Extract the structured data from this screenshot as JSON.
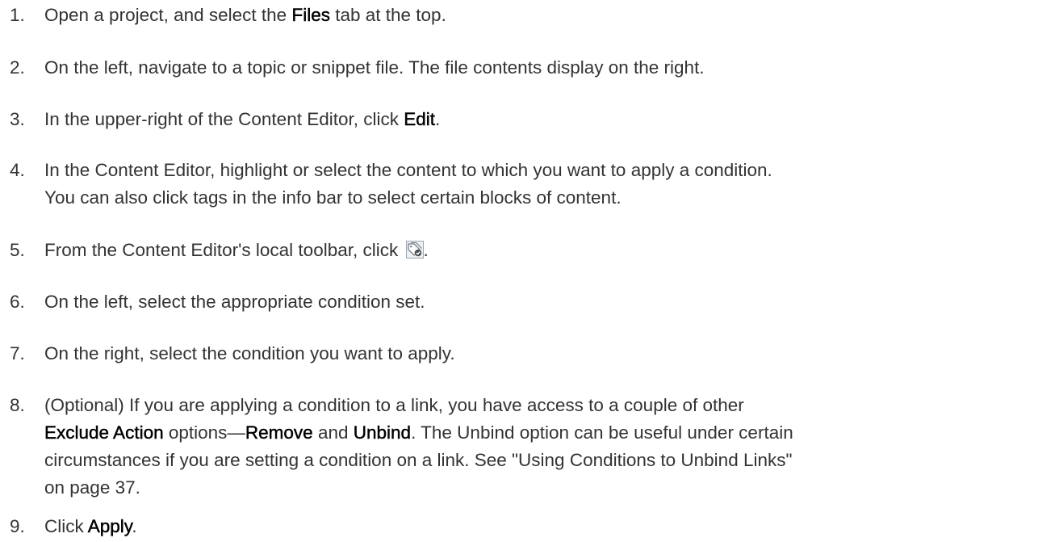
{
  "steps": [
    {
      "number": "1.",
      "p1": "Open a project, and select the ",
      "b1": "Files",
      "p2": " tab at the top."
    },
    {
      "number": "2.",
      "text": "On the left, navigate to a topic or snippet file. The file contents display on the right."
    },
    {
      "number": "3.",
      "p1": "In the upper-right of the Content Editor, click ",
      "b1": "Edit",
      "p2": "."
    },
    {
      "number": "4.",
      "line1": "In the Content Editor, highlight or select the content to which you want to apply a condition.",
      "line2": "You can also click tags in the info bar to select certain blocks of content."
    },
    {
      "number": "5.",
      "p1": "From the Content Editor's local toolbar, click ",
      "icon": "condition-tag-icon",
      "p2": "."
    },
    {
      "number": "6.",
      "text": "On the left, select the appropriate condition set."
    },
    {
      "number": "7.",
      "text": "On the right, select the condition you want to apply."
    },
    {
      "number": "8.",
      "line1": "(Optional) If you are applying a condition to a link, you have access to a couple of other",
      "b1": "Exclude Action",
      "p2": " options—",
      "b2": "Remove",
      "p3": " and ",
      "b3": "Unbind",
      "p4": ". The Unbind option can be useful under certain",
      "line3": "circumstances if you are setting a condition on a link. See \"Using Conditions to Unbind Links\"",
      "line4": "on page 37."
    },
    {
      "number": "9.",
      "p1": "Click ",
      "b1": "Apply",
      "p2": "."
    }
  ]
}
